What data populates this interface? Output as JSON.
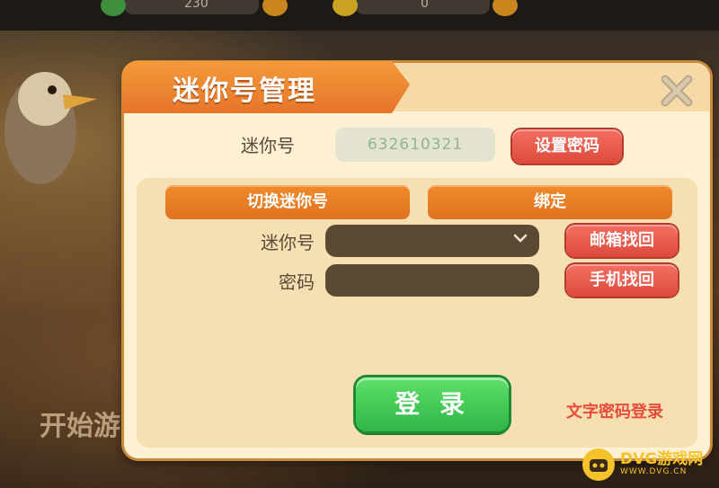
{
  "background": {
    "top_value_1": "230",
    "top_value_2": "0",
    "start_text": "开始游"
  },
  "dialog": {
    "title": "迷你号管理",
    "close_icon": "close-icon",
    "mini_id_label": "迷你号",
    "mini_id_value": "632610321",
    "set_password_label": "设置密码",
    "tabs": [
      {
        "label": "切换迷你号"
      },
      {
        "label": "绑定"
      }
    ],
    "form": {
      "account_label": "迷你号",
      "account_value": "",
      "password_label": "密码",
      "password_value": "",
      "email_recover_label": "邮箱找回",
      "phone_recover_label": "手机找回"
    },
    "login_label": "登 录",
    "text_password_login_label": "文字密码登录"
  },
  "watermark": {
    "main": "DVG游戏网",
    "sub": "WWW.DVG.CN"
  },
  "colors": {
    "accent_orange": "#e5752a",
    "button_red": "#dd4a3c",
    "login_green": "#2eb646",
    "panel_bg": "#fdf0d3"
  }
}
